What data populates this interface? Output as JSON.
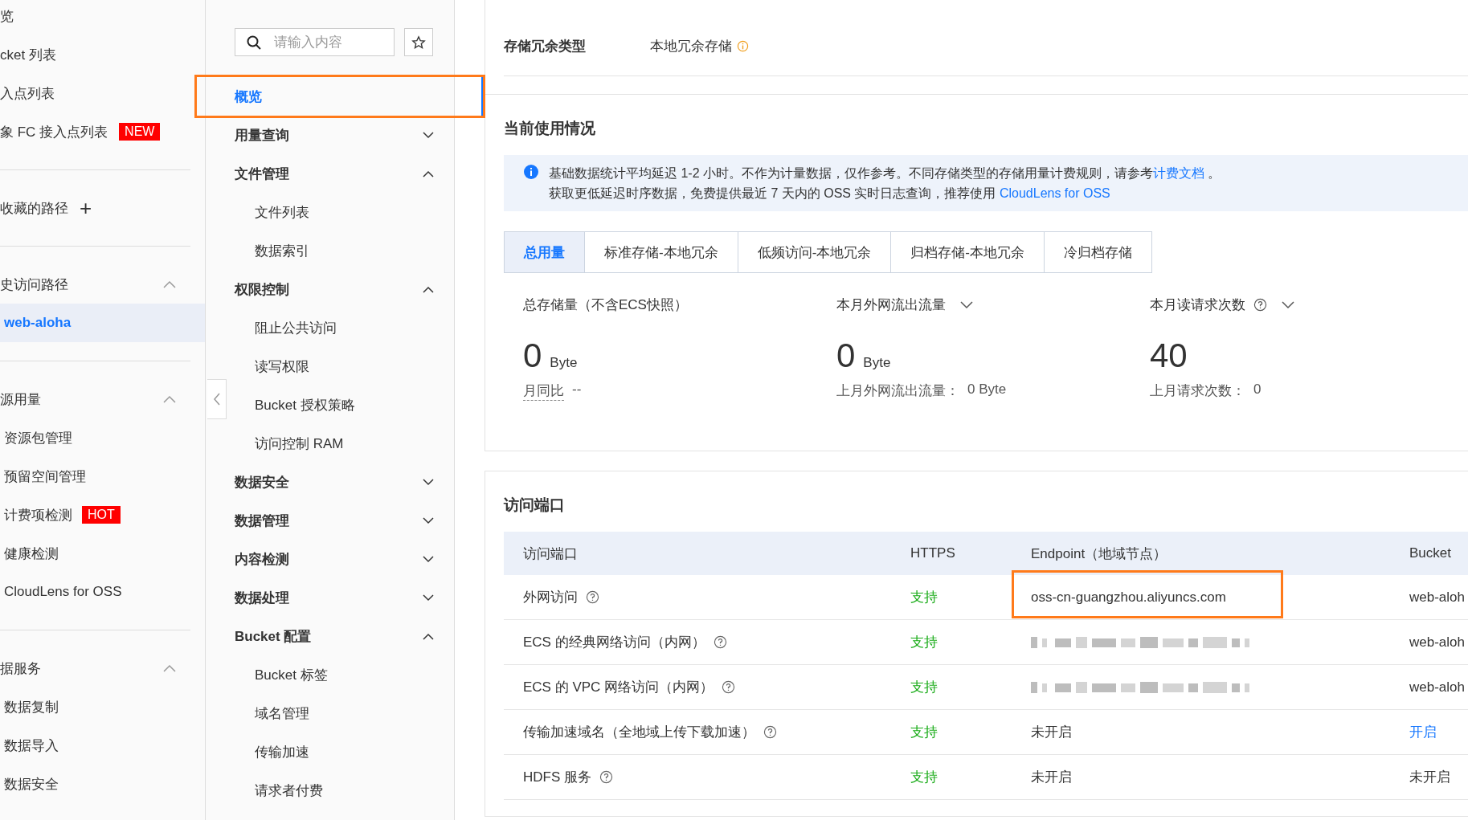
{
  "sidebar": {
    "sections": [
      {
        "title": "览"
      },
      {
        "title": "cket 列表"
      },
      {
        "title": "入点列表"
      },
      {
        "title": "象 FC 接入点列表",
        "badge": "NEW",
        "divider": true
      },
      {
        "title": "收藏的路径",
        "add": "+",
        "divider": true
      },
      {
        "title": "史访问路径",
        "expanded": true,
        "items": [
          {
            "label": "web-aloha",
            "selected": true
          }
        ],
        "divider": true
      },
      {
        "title": "源用量",
        "expanded": true,
        "items": [
          {
            "label": "资源包管理",
            "selected": false
          },
          {
            "label": "预留空间管理",
            "selected": false
          },
          {
            "label": "计费项检测",
            "badge": "HOT",
            "selected": false
          },
          {
            "label": "健康检测",
            "selected": false
          },
          {
            "label": "CloudLens for OSS",
            "selected": false
          }
        ],
        "divider": true
      },
      {
        "title": "据服务",
        "expanded": true,
        "items": [
          {
            "label": "数据复制",
            "selected": false
          },
          {
            "label": "数据导入",
            "selected": false
          },
          {
            "label": "数据安全",
            "selected": false
          }
        ]
      }
    ]
  },
  "nav": {
    "search": {
      "placeholder": "请输入内容"
    },
    "items": [
      {
        "label": "概览",
        "selected": true,
        "highlighted": true
      },
      {
        "label": "用量查询",
        "selected": false,
        "expanded": false
      },
      {
        "label": "文件管理",
        "selected": false,
        "expanded": true,
        "children": [
          {
            "label": "文件列表",
            "selected": false
          },
          {
            "label": "数据索引",
            "selected": false
          }
        ]
      },
      {
        "label": "权限控制",
        "selected": false,
        "expanded": true,
        "children": [
          {
            "label": "阻止公共访问",
            "selected": false
          },
          {
            "label": "读写权限",
            "selected": false
          },
          {
            "label": "Bucket 授权策略",
            "selected": false
          },
          {
            "label": "访问控制 RAM",
            "selected": false
          }
        ]
      },
      {
        "label": "数据安全",
        "selected": false,
        "expanded": false
      },
      {
        "label": "数据管理",
        "selected": false,
        "expanded": false
      },
      {
        "label": "内容检测",
        "selected": false,
        "expanded": false
      },
      {
        "label": "数据处理",
        "selected": false,
        "expanded": false
      },
      {
        "label": "Bucket 配置",
        "selected": false,
        "expanded": true,
        "children": [
          {
            "label": "Bucket 标签",
            "selected": false
          },
          {
            "label": "域名管理",
            "selected": false
          },
          {
            "label": "传输加速",
            "selected": false
          },
          {
            "label": "请求者付费",
            "selected": false
          }
        ]
      }
    ]
  },
  "redundancy": {
    "label": "存储冗余类型",
    "value": "本地冗余存储"
  },
  "usage": {
    "title": "当前使用情况",
    "notice": [
      {
        "text": "基础数据统计平均延迟 1-2 小时。不作为计量数据，仅作参考。不同存储类型的存储用量计费规则，请参考",
        "link": "计费文档",
        "after": " 。"
      },
      {
        "text": "获取更低延迟时序数据，免费提供最近 7 天内的 OSS 实时日志查询，推荐使用 ",
        "link": "CloudLens for OSS"
      }
    ],
    "tabs": [
      {
        "label": "总用量",
        "selected": true
      },
      {
        "label": "标准存储-本地冗余",
        "selected": false
      },
      {
        "label": "低频访问-本地冗余",
        "selected": false
      },
      {
        "label": "归档存储-本地冗余",
        "selected": false
      },
      {
        "label": "冷归档存储",
        "selected": false
      }
    ],
    "stats": [
      {
        "label": "总存储量（不含ECS快照）",
        "value": "0",
        "unit": "Byte",
        "sub_label": "月同比",
        "sub_value": "--",
        "underlined": true
      },
      {
        "label": "本月外网流出流量",
        "value": "0",
        "unit": "Byte",
        "sub_label": "上月外网流出流量：",
        "sub_value": "0 Byte",
        "underlined": false,
        "dropdown": true
      },
      {
        "label": "本月读请求次数",
        "value": "40",
        "sub_label": "上月请求次数：",
        "sub_value": "0",
        "underlined": false,
        "dropdown": true,
        "help": true
      }
    ]
  },
  "endpoints": {
    "title": "访问端口",
    "columns": [
      "访问端口",
      "HTTPS",
      "Endpoint（地域节点）",
      "Bucket"
    ],
    "rows": [
      {
        "name": "外网访问",
        "https": "支持",
        "endpoint": {
          "kind": "text",
          "text": "oss-cn-guangzhou.aliyuncs.com"
        },
        "highlighted": true,
        "bucket": {
          "kind": "text",
          "text": "web-aloh"
        }
      },
      {
        "name": "ECS 的经典网络访问（内网）",
        "https": "支持",
        "endpoint": {
          "kind": "redacted"
        },
        "bucket": {
          "kind": "text",
          "text": "web-aloh"
        }
      },
      {
        "name": "ECS 的 VPC 网络访问（内网）",
        "https": "支持",
        "endpoint": {
          "kind": "redacted"
        },
        "bucket": {
          "kind": "text",
          "text": "web-aloh"
        }
      },
      {
        "name": "传输加速域名（全地域上传下载加速）",
        "https": "支持",
        "endpoint": {
          "kind": "text",
          "text": "未开启"
        },
        "bucket": {
          "kind": "link",
          "text": "开启"
        }
      },
      {
        "name": "HDFS 服务",
        "https": "支持",
        "endpoint": {
          "kind": "text",
          "text": "未开启"
        },
        "bucket": {
          "kind": "text",
          "text": "未开启"
        }
      }
    ]
  }
}
